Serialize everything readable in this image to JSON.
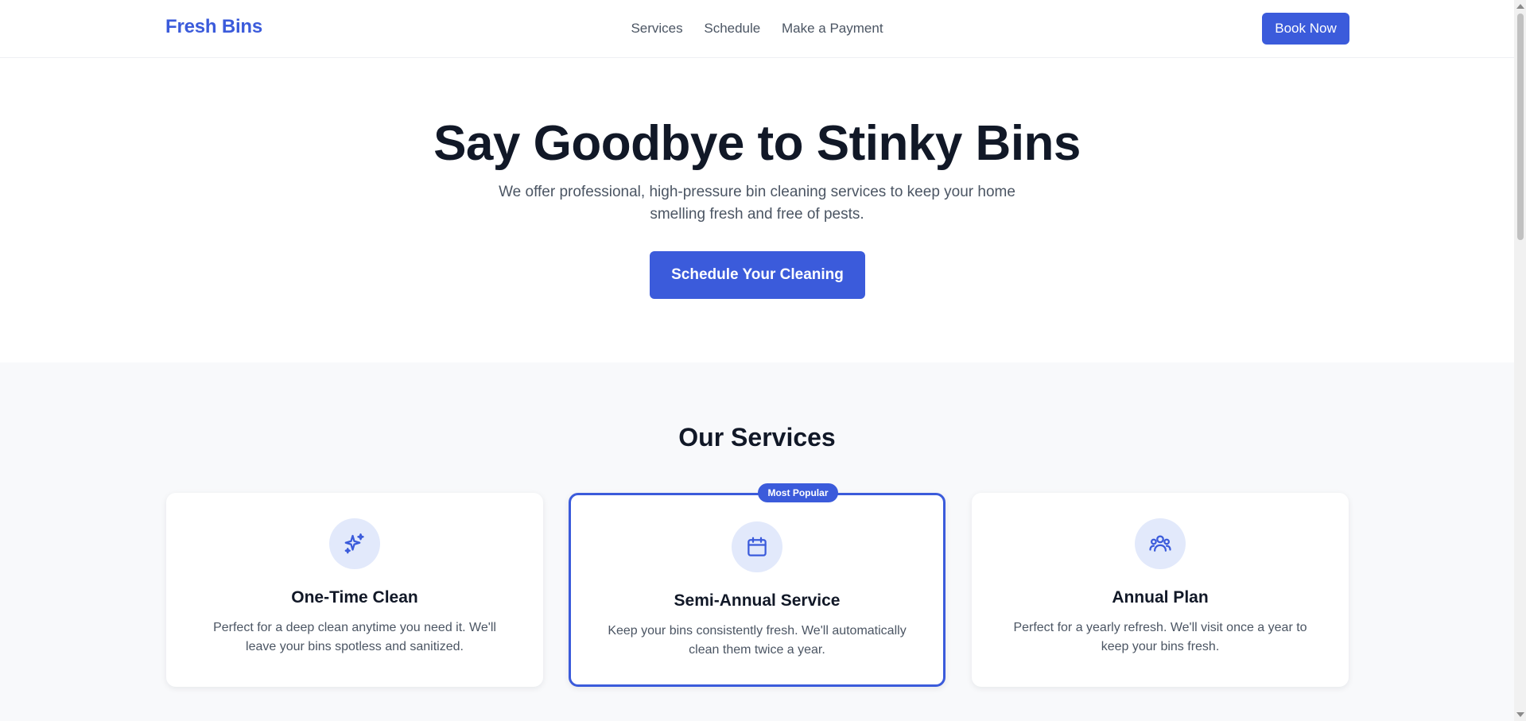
{
  "header": {
    "logo": "Fresh Bins",
    "nav": [
      "Services",
      "Schedule",
      "Make a Payment"
    ],
    "cta": "Book Now"
  },
  "hero": {
    "title": "Say Goodbye to Stinky Bins",
    "subtitle": "We offer professional, high-pressure bin cleaning services to keep your home smelling fresh and free of pests.",
    "button": "Schedule Your Cleaning"
  },
  "services": {
    "title": "Our Services",
    "badge": "Most Popular",
    "cards": [
      {
        "icon": "sparkles-icon",
        "title": "One-Time Clean",
        "description": "Perfect for a deep clean anytime you need it. We'll leave your bins spotless and sanitized."
      },
      {
        "icon": "calendar-icon",
        "title": "Semi-Annual Service",
        "description": "Keep your bins consistently fresh. We'll automatically clean them twice a year."
      },
      {
        "icon": "users-icon",
        "title": "Annual Plan",
        "description": "Perfect for a yearly refresh. We'll visit once a year to keep your bins fresh."
      }
    ]
  },
  "colors": {
    "brand": "#3b5bdb",
    "text": "#111827",
    "muted": "#4b5563",
    "section_bg": "#f8f9fb",
    "icon_bg": "#e2e9fb"
  }
}
